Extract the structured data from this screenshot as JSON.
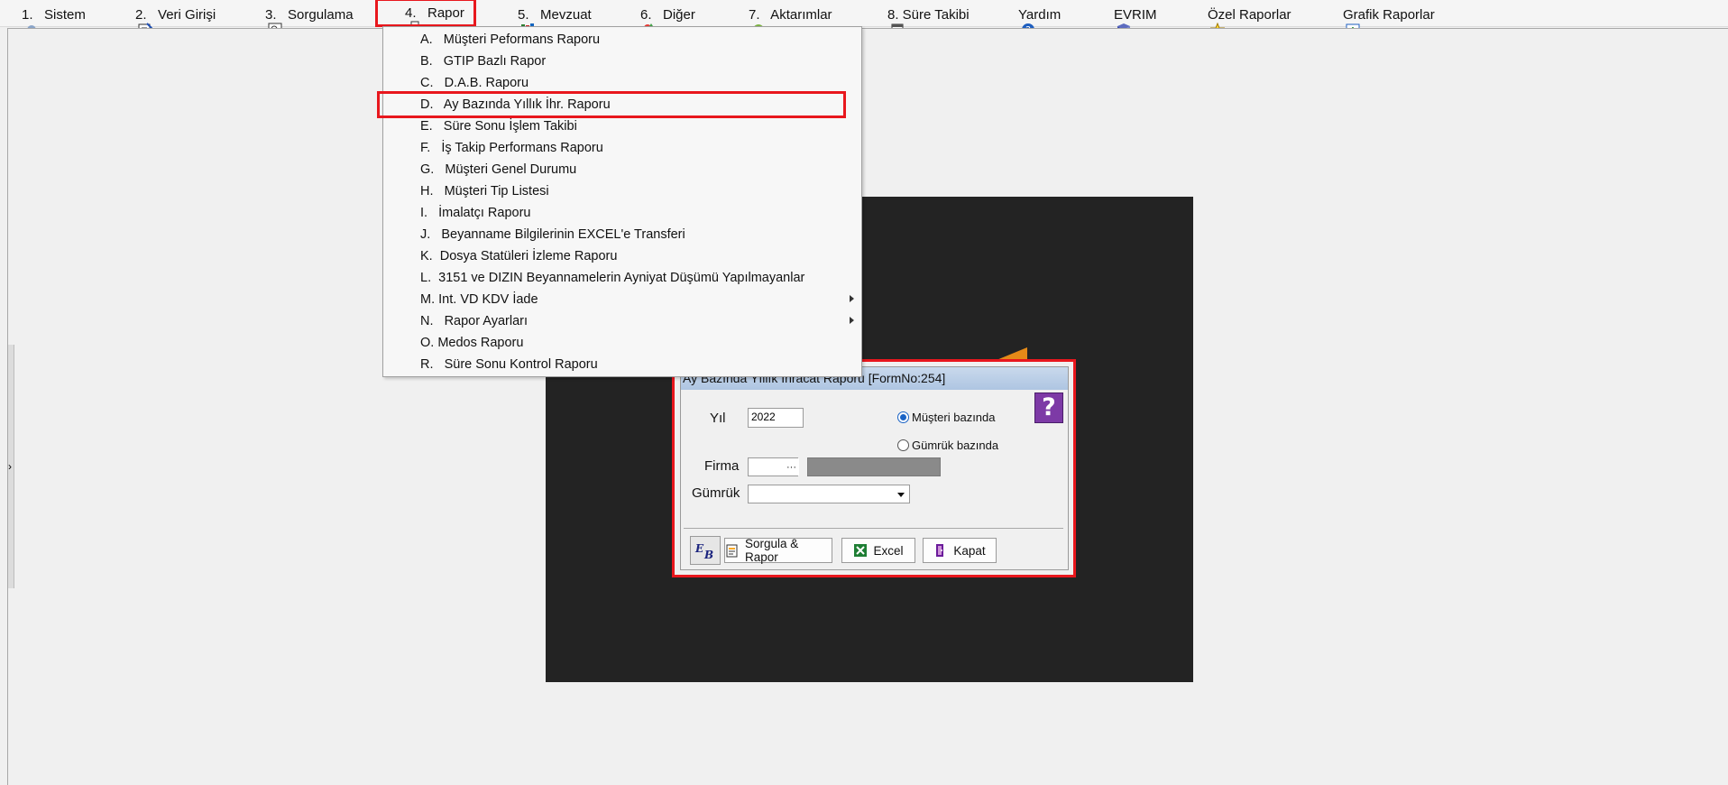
{
  "menubar": [
    {
      "label": "1.   Sistem",
      "icon": "system-icon"
    },
    {
      "label": "2.   Veri Girişi",
      "icon": "data-entry-icon"
    },
    {
      "label": "3.   Sorgulama",
      "icon": "query-icon"
    },
    {
      "label": "4.   Rapor",
      "icon": "printer-icon"
    },
    {
      "label": "5.   Mevzuat",
      "icon": "books-icon"
    },
    {
      "label": "6.   Diğer",
      "icon": "shapes-icon"
    },
    {
      "label": "7.   Aktarımlar",
      "icon": "transfer-icon"
    },
    {
      "label": "8. Süre Takibi",
      "icon": "calendar-icon"
    },
    {
      "label": "Yardım",
      "icon": "help-icon"
    },
    {
      "label": "EVRIM",
      "icon": "book-icon"
    },
    {
      "label": "Özel Raporlar",
      "icon": "star-icon"
    },
    {
      "label": "Grafik Raporlar",
      "icon": "chart-icon"
    }
  ],
  "dropdown": [
    {
      "label": "A.   Müşteri Peformans Raporu"
    },
    {
      "label": "B.   GTIP Bazlı Rapor"
    },
    {
      "label": "C.   D.A.B. Raporu"
    },
    {
      "label": "D.   Ay Bazında Yıllık İhr. Raporu"
    },
    {
      "label": "E.   Süre Sonu İşlem Takibi"
    },
    {
      "label": "F.   İş Takip Performans Raporu"
    },
    {
      "label": "G.   Müşteri Genel Durumu"
    },
    {
      "label": "H.   Müşteri Tip Listesi"
    },
    {
      "label": "I.   İmalatçı Raporu"
    },
    {
      "label": "J.   Beyanname Bilgilerinin EXCEL'e Transferi"
    },
    {
      "label": "K.  Dosya Statüleri İzleme Raporu"
    },
    {
      "label": "L.  3151 ve DIZIN Beyannamelerin Ayniyat Düşümü Yapılmayanlar"
    },
    {
      "label": "M. Int. VD KDV İade"
    },
    {
      "label": "N.   Rapor Ayarları"
    },
    {
      "label": "O. Medos Raporu"
    },
    {
      "label": "R.   Süre Sonu Kontrol Raporu"
    }
  ],
  "dialog": {
    "title": "Ay Bazında Yıllık İhracat Raporu [FormNo:254]",
    "yil_label": "Yıl",
    "yil_value": "2022",
    "radio_musteri": "Müşteri bazında",
    "radio_gumruk": "Gümrük bazında",
    "firma_label": "Firma",
    "firma_button": "···",
    "gumruk_label": "Gümrük",
    "btn_sorgula": "Sorgula & Rapor",
    "btn_excel": "Excel",
    "btn_kapat": "Kapat",
    "help_glyph": "?"
  }
}
